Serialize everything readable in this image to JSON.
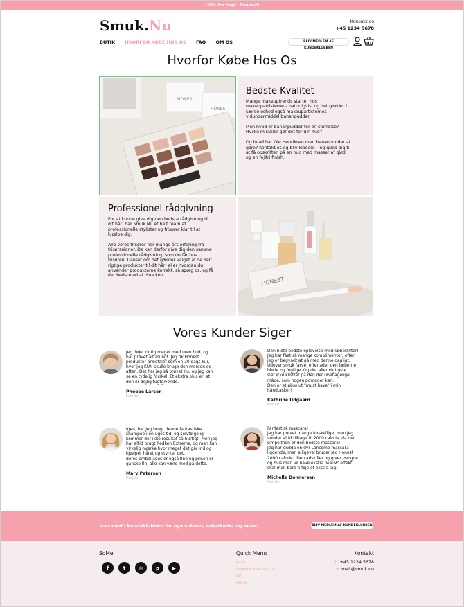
{
  "topbar": {
    "text": "100% fra fragt i Danmark"
  },
  "logo": {
    "part1": "Smuk.",
    "part2": "Nu"
  },
  "contact": {
    "label": "Kontakt os",
    "phone": "+45 1234 5678"
  },
  "nav": {
    "items": [
      "BUTIK",
      "HVORFOR KØBE HOS OS",
      "FAQ",
      "OM OS"
    ],
    "active_index": 1,
    "member_button": "BLIV MEDLEM AF KUNDEKLUBBEN"
  },
  "page_title": "Hvorfor Købe Hos Os",
  "features": [
    {
      "title": "Bedste Kvalitet",
      "body": "Mange makeuptrends starter hos\nmakeupartisterne – naturligvis, og det gælder i\nsærdeleshed også makeupartisternes\nvidundermiddel bananpudder.\n\nMen hvad er bananpudder for en størrelse?\nHvilke mirakler gør det for din hud?\n\nOg hvad har Ole Henriksen med bananpudder at\ngøre? Kontakt os og bliv klogere – og glæd dig til\nat få opskriften på en hud med masser af glød\nog en fejlfri finish."
    },
    {
      "title": "Professionel rådgivning",
      "body": "For at kunne give dig den bedste rådgivning til\ndit hår, har Smuk.Nu et helt team af\nprofessionelle stylister og frisører klar til at\nhjælpe dig.\n\nAlle vores frisører har mange års erfaring fra\nfrisørsaloner. De kan derfor give dig den samme\nprofessionelle rådgivning, som du får hos\nfrisøren. Uanset om det gælder valget af de helt\nrigtige produkter til dit hår, eller hvordan du\nanvender produkterne korrekt, så spørg os, og få\ndet bedste ud af dine køb."
    }
  ],
  "reviews_title": "Vores Kunder Siger",
  "reviews": [
    {
      "text": "Jeg døjer rigtig meget med uren hud, og\nhar prøvet alt muligt. Jeg fik Honest\nprodukter anbefalet som en 30 dags kur,\nhvor jeg KUN skulle bruge den morgen og\naften. Det har jeg så prøvet nu, og jeg kan\nse en tydelig forskel. Et ekstra plus er, at\nden er dejlig fugtgivende.",
      "name": "Phoebe Larsen",
      "role": "Kunde"
    },
    {
      "text": "Den hidtil bedste oplevelse med læbestifter!\nJeg har fået så mange komplimenter, efter\njeg er begyndt at gå med denne dagligt.\nUdover smuk farve, efterlader den læberne\nbløde og fugtige. Og det aller vigtigste\nslet ikke klistret på den der ubehagelige\nmåde, som nogen pomader kan.\nDen er et absolut \"must have\" i min\nhåndtaske!!",
      "name": "Kathrine Udgaard",
      "role": "Kunde"
    },
    {
      "text": "Igen, har jeg brugt denne fantastiske\nshampoo i en uges tid, og selvfølgelig\nkommer der ikke resultat så hurtigt! Men jeg\nhar altid brugt Redken Extreme, og man kan\nvirkelig mærke hvor meget det går ind og\nhjælper håret og styrker det.\nderes emballages er også fine og prisen er\nganske fin, alle kan være med på dette.",
      "name": "Mary Petersen",
      "role": "Kunde"
    },
    {
      "text": "Fantastisk mascara!\nJeg har prøvet mange forskellige, men jeg\nvender altid tilbage til 2000 calorie, da det\nsimpelthen er den bedste mascara!\nJeg har endda en dyr Lancome mascara\nliggende, men alligevel bruger jeg Honest\n2000 calorie.. Den adskiller og giver længde\nog hvis man vil have ekstra 'wauw' effekt,\nskal man bare tilføje et ekstra lag.",
      "name": "Michelle Donnersen",
      "role": "Kunde"
    }
  ],
  "signup": {
    "message": "Vær med i kundeklubben for nye videoer, rabatkoder og mere!",
    "button": "BLIV MEDLEM AF KUNDEKLUBBEN"
  },
  "footer": {
    "some_title": "SoMe",
    "social_icons": [
      "facebook-icon",
      "twitter-icon",
      "instagram-icon",
      "pinterest-icon",
      "youtube-icon"
    ],
    "quick_menu_title": "Quick Menu",
    "quick_menu": [
      "BUTIK",
      "HVORFOR KØBE HOS OS",
      "FAQ",
      "OM OS"
    ],
    "contact_title": "Kontakt",
    "phone": "+45 1234 5678",
    "email": "mail@smuk.nu"
  },
  "colors": {
    "accent": "#f7a0ae",
    "panel": "#f4eced",
    "highlight": "#6fc38f"
  }
}
